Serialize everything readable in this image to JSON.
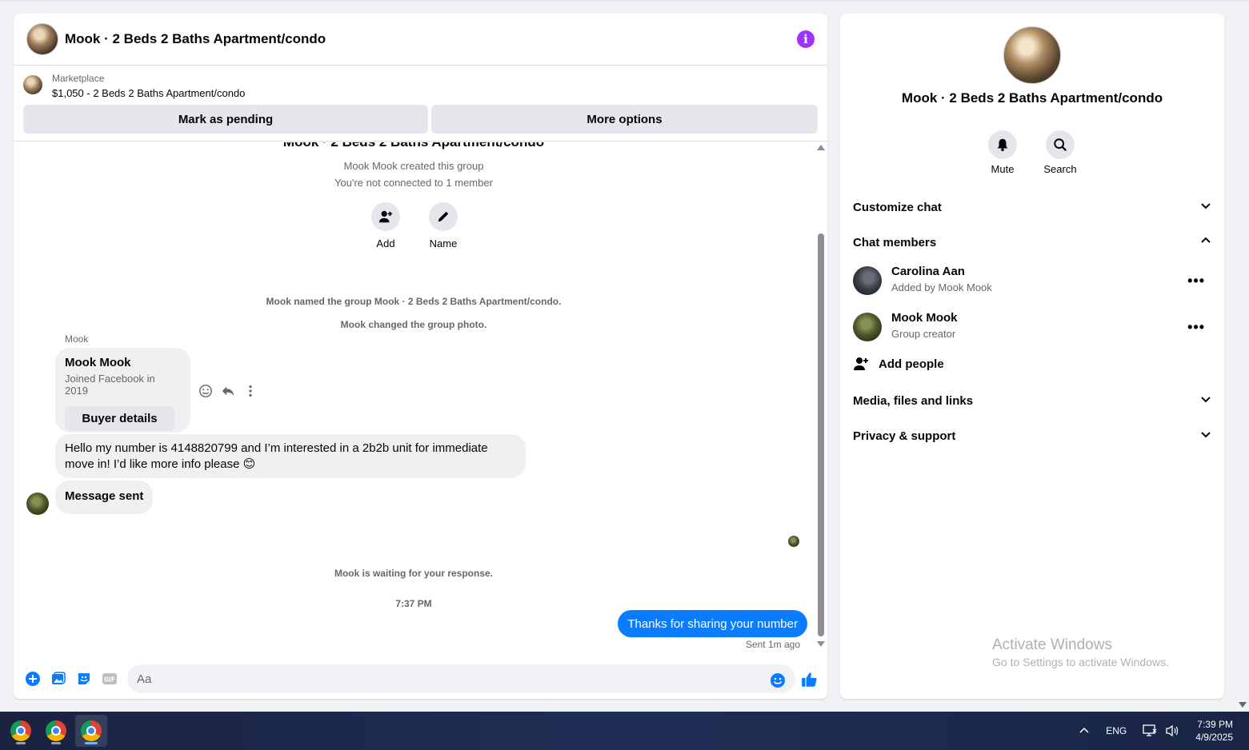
{
  "chat": {
    "title": "Mook · 2 Beds 2 Baths Apartment/condo",
    "listing_source": "Marketplace",
    "listing_price": "$1,050 - 2 Beds 2 Baths Apartment/condo",
    "mark_pending_label": "Mark as pending",
    "more_options_label": "More options"
  },
  "thread": {
    "group_name": "Mook · 2 Beds 2 Baths Apartment/condo",
    "created_line": "Mook Mook created this group",
    "connection_line": "You're not connected to 1 member",
    "add_label": "Add",
    "name_label": "Name",
    "named_event": "Mook named the group Mook · 2 Beds 2 Baths Apartment/condo.",
    "photo_event": "Mook changed the group photo.",
    "sender_label": "Mook",
    "card_name": "Mook Mook",
    "card_sub": "Joined Facebook in 2019",
    "buyer_details_label": "Buyer details",
    "message_1": "Hello my number is 4148820799 and I’m interested in a 2b2b unit for immediate move in! I’d like more info please 😊",
    "message_2": "Message sent",
    "waiting_line": "Mook is waiting for your response.",
    "timestamp": "7:37 PM",
    "outgoing_message": "Thanks for sharing your number",
    "sent_status": "Sent 1m ago"
  },
  "composer": {
    "placeholder": "Aa"
  },
  "info": {
    "title": "Mook · 2 Beds 2 Baths Apartment/condo",
    "mute_label": "Mute",
    "search_label": "Search",
    "customize_label": "Customize chat",
    "members_label": "Chat members",
    "members": [
      {
        "name": "Carolina Aan",
        "sub": "Added by Mook Mook"
      },
      {
        "name": "Mook Mook",
        "sub": "Group creator"
      }
    ],
    "add_people_label": "Add people",
    "media_label": "Media, files and links",
    "privacy_label": "Privacy & support"
  },
  "watermark": {
    "line1": "Activate Windows",
    "line2": "Go to Settings to activate Windows."
  },
  "taskbar": {
    "language": "ENG",
    "time": "7:39 PM",
    "date": "4/9/2025"
  },
  "colors": {
    "accent_blue": "#0a7cff",
    "info_purple": "#a033ff",
    "bubble_gray": "#f0f0f0"
  }
}
